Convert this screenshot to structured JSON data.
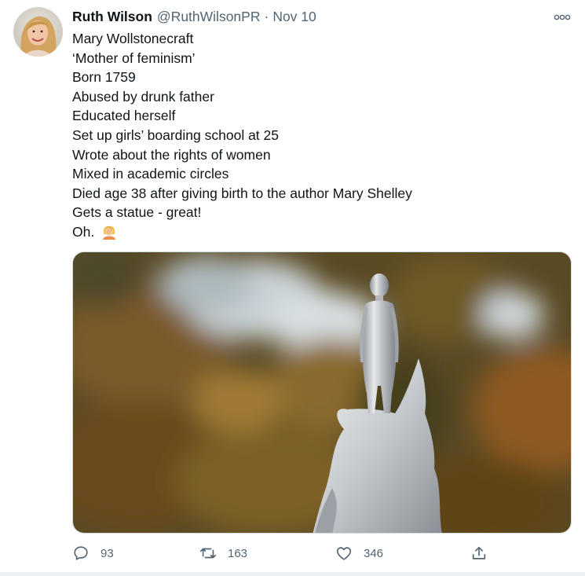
{
  "tweet": {
    "author_name": "Ruth Wilson",
    "handle": "@RuthWilsonPR",
    "separator": "·",
    "time": "Nov 10",
    "lines": [
      "Mary Wollstonecraft",
      "‘Mother of feminism’",
      "Born 1759",
      "Abused by drunk father",
      "Educated herself",
      "Set up girls’ boarding school at 25",
      "Wrote about the rights of women",
      "Mixed in academic circles",
      "Died age 38 after giving birth to the author Mary Shelley",
      "Gets a statue - great!",
      "Oh."
    ],
    "emoji_icon": "woman-facepalming-icon",
    "media_icon": "silver-statue-photo"
  },
  "actions": {
    "replies": "93",
    "retweets": "163",
    "likes": "346",
    "share_icon": "share-icon"
  },
  "colors": {
    "text": "#0f1419",
    "muted": "#536471",
    "border": "#cfd9de"
  }
}
